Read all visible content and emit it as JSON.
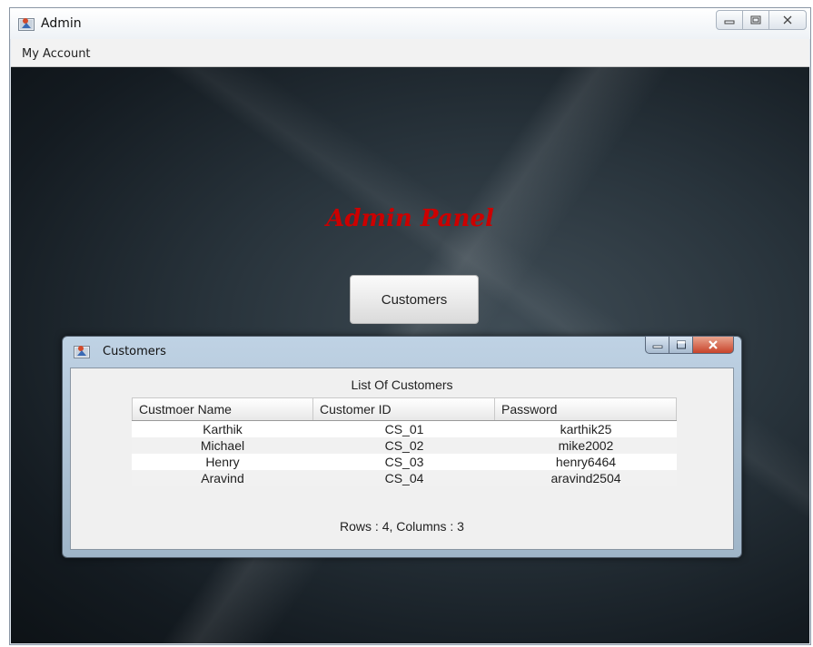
{
  "window": {
    "title": "Admin",
    "icon": "java-app-icon"
  },
  "menubar": {
    "items": [
      {
        "label": "My Account"
      }
    ]
  },
  "panel": {
    "title": "Admin Panel",
    "customers_button": "Customers",
    "title_color": "#cc0000"
  },
  "dialog": {
    "title": "Customers",
    "heading": "List Of Customers",
    "table": {
      "columns": [
        "Custmoer Name",
        "Customer ID",
        "Password"
      ],
      "rows": [
        [
          "Karthik",
          "CS_01",
          "karthik25"
        ],
        [
          "Michael",
          "CS_02",
          "mike2002"
        ],
        [
          "Henry",
          "CS_03",
          "henry6464"
        ],
        [
          "Aravind",
          "CS_04",
          "aravind2504"
        ]
      ]
    },
    "status": "Rows : 4, Columns : 3"
  }
}
